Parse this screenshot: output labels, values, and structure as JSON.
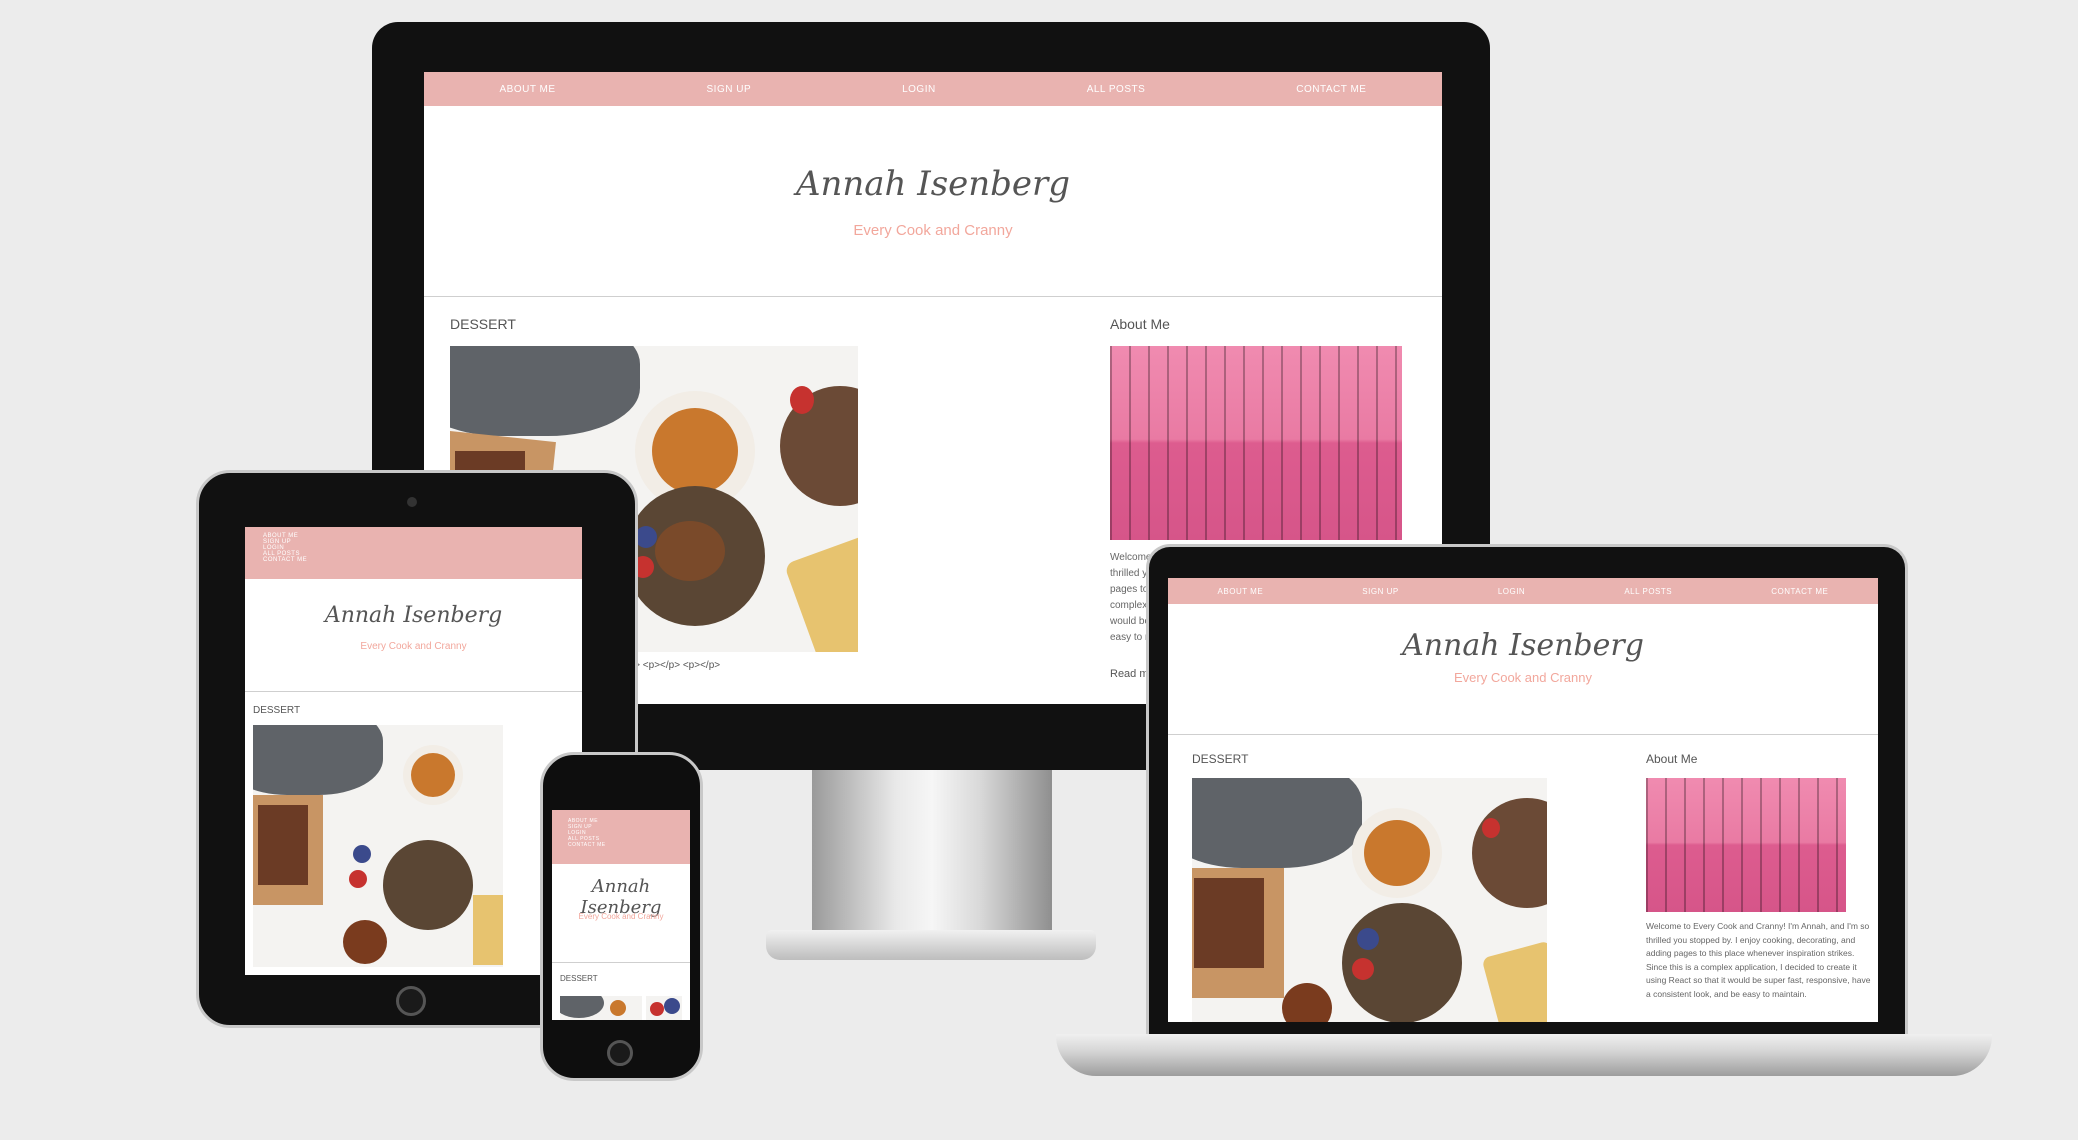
{
  "site": {
    "nav": [
      "ABOUT ME",
      "SIGN UP",
      "LOGIN",
      "ALL POSTS",
      "CONTACT ME"
    ],
    "brand": "Annah Isenberg",
    "tagline": "Every Cook and Cranny",
    "section_title": "DESSERT",
    "about_title": "About Me",
    "about_text": "Welcome to Every Cook and Cranny! I'm Annah, and I'm so thrilled you stopped by. I enjoy cooking, decorating, and adding pages to this place whenever inspiration strikes. Since this is a complex application, I decided to create it using React so that it would be super fast, responsive, have a consistent look, and be easy to maintain.",
    "read_more": "Read more",
    "raw_html_snippet": "</p> <p></p> <p></p>"
  },
  "colors": {
    "nav_bg": "#e9b3b0",
    "tagline": "#f2a79c",
    "page_bg": "#ececec"
  },
  "devices": [
    "desktop-monitor",
    "tablet",
    "phone",
    "laptop"
  ]
}
